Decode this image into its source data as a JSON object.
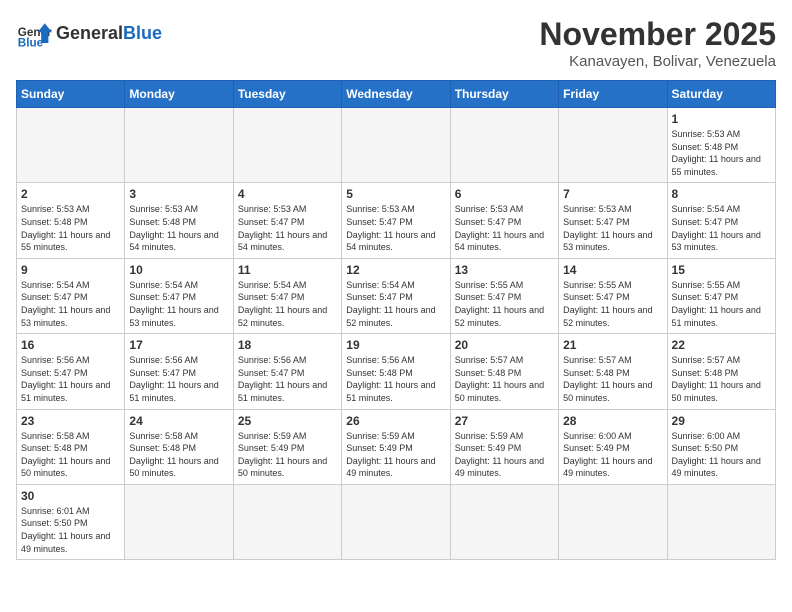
{
  "header": {
    "logo_general": "General",
    "logo_blue": "Blue",
    "month_title": "November 2025",
    "location": "Kanavayen, Bolivar, Venezuela"
  },
  "days_of_week": [
    "Sunday",
    "Monday",
    "Tuesday",
    "Wednesday",
    "Thursday",
    "Friday",
    "Saturday"
  ],
  "weeks": [
    [
      {
        "day": "",
        "info": ""
      },
      {
        "day": "",
        "info": ""
      },
      {
        "day": "",
        "info": ""
      },
      {
        "day": "",
        "info": ""
      },
      {
        "day": "",
        "info": ""
      },
      {
        "day": "",
        "info": ""
      },
      {
        "day": "1",
        "info": "Sunrise: 5:53 AM\nSunset: 5:48 PM\nDaylight: 11 hours\nand 55 minutes."
      }
    ],
    [
      {
        "day": "2",
        "info": "Sunrise: 5:53 AM\nSunset: 5:48 PM\nDaylight: 11 hours\nand 55 minutes."
      },
      {
        "day": "3",
        "info": "Sunrise: 5:53 AM\nSunset: 5:48 PM\nDaylight: 11 hours\nand 54 minutes."
      },
      {
        "day": "4",
        "info": "Sunrise: 5:53 AM\nSunset: 5:47 PM\nDaylight: 11 hours\nand 54 minutes."
      },
      {
        "day": "5",
        "info": "Sunrise: 5:53 AM\nSunset: 5:47 PM\nDaylight: 11 hours\nand 54 minutes."
      },
      {
        "day": "6",
        "info": "Sunrise: 5:53 AM\nSunset: 5:47 PM\nDaylight: 11 hours\nand 54 minutes."
      },
      {
        "day": "7",
        "info": "Sunrise: 5:53 AM\nSunset: 5:47 PM\nDaylight: 11 hours\nand 53 minutes."
      },
      {
        "day": "8",
        "info": "Sunrise: 5:54 AM\nSunset: 5:47 PM\nDaylight: 11 hours\nand 53 minutes."
      }
    ],
    [
      {
        "day": "9",
        "info": "Sunrise: 5:54 AM\nSunset: 5:47 PM\nDaylight: 11 hours\nand 53 minutes."
      },
      {
        "day": "10",
        "info": "Sunrise: 5:54 AM\nSunset: 5:47 PM\nDaylight: 11 hours\nand 53 minutes."
      },
      {
        "day": "11",
        "info": "Sunrise: 5:54 AM\nSunset: 5:47 PM\nDaylight: 11 hours\nand 52 minutes."
      },
      {
        "day": "12",
        "info": "Sunrise: 5:54 AM\nSunset: 5:47 PM\nDaylight: 11 hours\nand 52 minutes."
      },
      {
        "day": "13",
        "info": "Sunrise: 5:55 AM\nSunset: 5:47 PM\nDaylight: 11 hours\nand 52 minutes."
      },
      {
        "day": "14",
        "info": "Sunrise: 5:55 AM\nSunset: 5:47 PM\nDaylight: 11 hours\nand 52 minutes."
      },
      {
        "day": "15",
        "info": "Sunrise: 5:55 AM\nSunset: 5:47 PM\nDaylight: 11 hours\nand 51 minutes."
      }
    ],
    [
      {
        "day": "16",
        "info": "Sunrise: 5:56 AM\nSunset: 5:47 PM\nDaylight: 11 hours\nand 51 minutes."
      },
      {
        "day": "17",
        "info": "Sunrise: 5:56 AM\nSunset: 5:47 PM\nDaylight: 11 hours\nand 51 minutes."
      },
      {
        "day": "18",
        "info": "Sunrise: 5:56 AM\nSunset: 5:47 PM\nDaylight: 11 hours\nand 51 minutes."
      },
      {
        "day": "19",
        "info": "Sunrise: 5:56 AM\nSunset: 5:48 PM\nDaylight: 11 hours\nand 51 minutes."
      },
      {
        "day": "20",
        "info": "Sunrise: 5:57 AM\nSunset: 5:48 PM\nDaylight: 11 hours\nand 50 minutes."
      },
      {
        "day": "21",
        "info": "Sunrise: 5:57 AM\nSunset: 5:48 PM\nDaylight: 11 hours\nand 50 minutes."
      },
      {
        "day": "22",
        "info": "Sunrise: 5:57 AM\nSunset: 5:48 PM\nDaylight: 11 hours\nand 50 minutes."
      }
    ],
    [
      {
        "day": "23",
        "info": "Sunrise: 5:58 AM\nSunset: 5:48 PM\nDaylight: 11 hours\nand 50 minutes."
      },
      {
        "day": "24",
        "info": "Sunrise: 5:58 AM\nSunset: 5:48 PM\nDaylight: 11 hours\nand 50 minutes."
      },
      {
        "day": "25",
        "info": "Sunrise: 5:59 AM\nSunset: 5:49 PM\nDaylight: 11 hours\nand 50 minutes."
      },
      {
        "day": "26",
        "info": "Sunrise: 5:59 AM\nSunset: 5:49 PM\nDaylight: 11 hours\nand 49 minutes."
      },
      {
        "day": "27",
        "info": "Sunrise: 5:59 AM\nSunset: 5:49 PM\nDaylight: 11 hours\nand 49 minutes."
      },
      {
        "day": "28",
        "info": "Sunrise: 6:00 AM\nSunset: 5:49 PM\nDaylight: 11 hours\nand 49 minutes."
      },
      {
        "day": "29",
        "info": "Sunrise: 6:00 AM\nSunset: 5:50 PM\nDaylight: 11 hours\nand 49 minutes."
      }
    ],
    [
      {
        "day": "30",
        "info": "Sunrise: 6:01 AM\nSunset: 5:50 PM\nDaylight: 11 hours\nand 49 minutes."
      },
      {
        "day": "",
        "info": ""
      },
      {
        "day": "",
        "info": ""
      },
      {
        "day": "",
        "info": ""
      },
      {
        "day": "",
        "info": ""
      },
      {
        "day": "",
        "info": ""
      },
      {
        "day": "",
        "info": ""
      }
    ]
  ]
}
